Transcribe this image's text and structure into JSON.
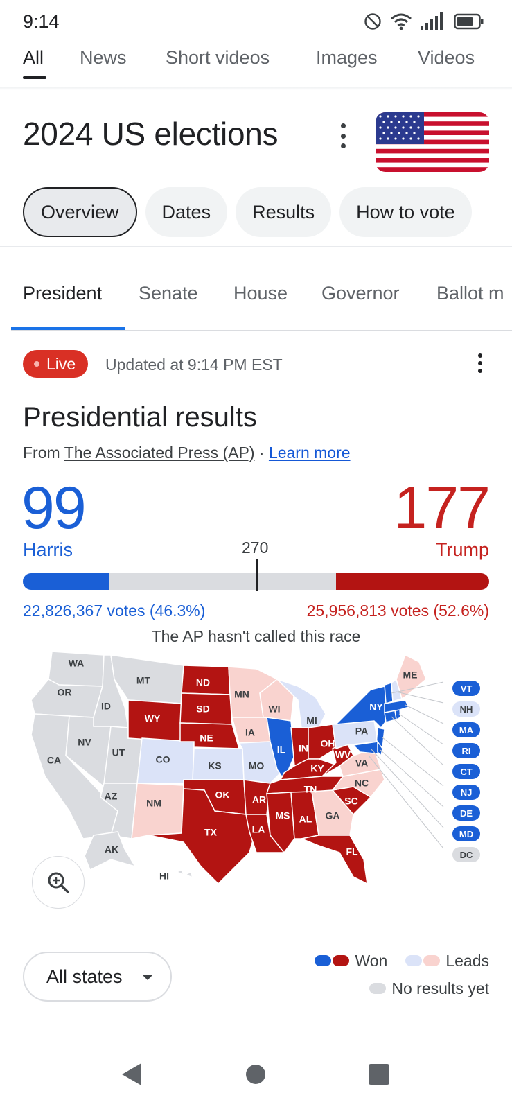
{
  "status": {
    "time": "9:14"
  },
  "search_tabs": [
    "All",
    "News",
    "Short videos",
    "Images",
    "Videos"
  ],
  "heading": {
    "title": "2024 US elections"
  },
  "chips": [
    "Overview",
    "Dates",
    "Results",
    "How to vote"
  ],
  "sub_tabs": [
    "President",
    "Senate",
    "House",
    "Governor",
    "Ballot m"
  ],
  "live": {
    "badge": "Live",
    "updated": "Updated at 9:14 PM EST"
  },
  "results": {
    "title": "Presidential results",
    "source_prefix": "From ",
    "source_name": "The Associated Press (AP)",
    "source_sep": " · ",
    "learn_more": "Learn more",
    "harris": {
      "ev": "99",
      "name": "Harris",
      "votes": "22,826,367 votes (46.3%)"
    },
    "trump": {
      "ev": "177",
      "name": "Trump",
      "votes": "25,956,813 votes (52.6%)"
    },
    "threshold": "270",
    "not_called": "The AP hasn't called this race"
  },
  "chart_data": {
    "type": "bar",
    "total_electoral_votes": 538,
    "threshold": 270,
    "series": [
      {
        "name": "Harris",
        "electoral_votes": 99,
        "votes": 22826367,
        "vote_pct": 46.3
      },
      {
        "name": "Trump",
        "electoral_votes": 177,
        "votes": 25956813,
        "vote_pct": 52.6
      }
    ]
  },
  "colors": {
    "dem_won": "#1a5fd6",
    "rep_won": "#b31412",
    "dem_leads": "#dbe3f8",
    "rep_leads": "#f9d3cf",
    "no_results": "#dadce0"
  },
  "map": {
    "states": [
      {
        "abbr": "WA",
        "status": "none"
      },
      {
        "abbr": "OR",
        "status": "none"
      },
      {
        "abbr": "CA",
        "status": "none"
      },
      {
        "abbr": "ID",
        "status": "none"
      },
      {
        "abbr": "NV",
        "status": "none"
      },
      {
        "abbr": "MT",
        "status": "none"
      },
      {
        "abbr": "UT",
        "status": "none"
      },
      {
        "abbr": "AZ",
        "status": "none"
      },
      {
        "abbr": "WY",
        "status": "rep_won"
      },
      {
        "abbr": "CO",
        "status": "dem_leads"
      },
      {
        "abbr": "NM",
        "status": "rep_leads"
      },
      {
        "abbr": "ND",
        "status": "rep_won"
      },
      {
        "abbr": "SD",
        "status": "rep_won"
      },
      {
        "abbr": "NE",
        "status": "rep_won"
      },
      {
        "abbr": "KS",
        "status": "dem_leads"
      },
      {
        "abbr": "OK",
        "status": "rep_won"
      },
      {
        "abbr": "TX",
        "status": "rep_won"
      },
      {
        "abbr": "MN",
        "status": "rep_leads"
      },
      {
        "abbr": "IA",
        "status": "rep_leads"
      },
      {
        "abbr": "MO",
        "status": "dem_leads"
      },
      {
        "abbr": "AR",
        "status": "rep_won"
      },
      {
        "abbr": "LA",
        "status": "rep_won"
      },
      {
        "abbr": "WI",
        "status": "rep_leads"
      },
      {
        "abbr": "IL",
        "status": "dem_won"
      },
      {
        "abbr": "MI",
        "status": "dem_leads"
      },
      {
        "abbr": "IN",
        "status": "rep_won"
      },
      {
        "abbr": "OH",
        "status": "rep_won"
      },
      {
        "abbr": "KY",
        "status": "rep_won"
      },
      {
        "abbr": "TN",
        "status": "rep_won"
      },
      {
        "abbr": "MS",
        "status": "rep_won"
      },
      {
        "abbr": "AL",
        "status": "rep_won"
      },
      {
        "abbr": "GA",
        "status": "rep_leads"
      },
      {
        "abbr": "FL",
        "status": "rep_won"
      },
      {
        "abbr": "SC",
        "status": "rep_won"
      },
      {
        "abbr": "NC",
        "status": "rep_leads"
      },
      {
        "abbr": "VA",
        "status": "rep_leads"
      },
      {
        "abbr": "WV",
        "status": "rep_won"
      },
      {
        "abbr": "PA",
        "status": "dem_leads"
      },
      {
        "abbr": "NY",
        "status": "dem_won"
      },
      {
        "abbr": "ME",
        "status": "rep_leads"
      },
      {
        "abbr": "AK",
        "status": "none"
      },
      {
        "abbr": "HI",
        "status": "none"
      }
    ],
    "small_states": [
      {
        "abbr": "VT",
        "status": "dem_won"
      },
      {
        "abbr": "NH",
        "status": "dem_leads"
      },
      {
        "abbr": "MA",
        "status": "dem_won"
      },
      {
        "abbr": "RI",
        "status": "dem_won"
      },
      {
        "abbr": "CT",
        "status": "dem_won"
      },
      {
        "abbr": "NJ",
        "status": "dem_won"
      },
      {
        "abbr": "DE",
        "status": "dem_won"
      },
      {
        "abbr": "MD",
        "status": "dem_won"
      },
      {
        "abbr": "DC",
        "status": "none"
      }
    ]
  },
  "footer": {
    "all_states": "All states",
    "legend": {
      "won": "Won",
      "leads": "Leads",
      "no_results": "No results yet"
    }
  }
}
